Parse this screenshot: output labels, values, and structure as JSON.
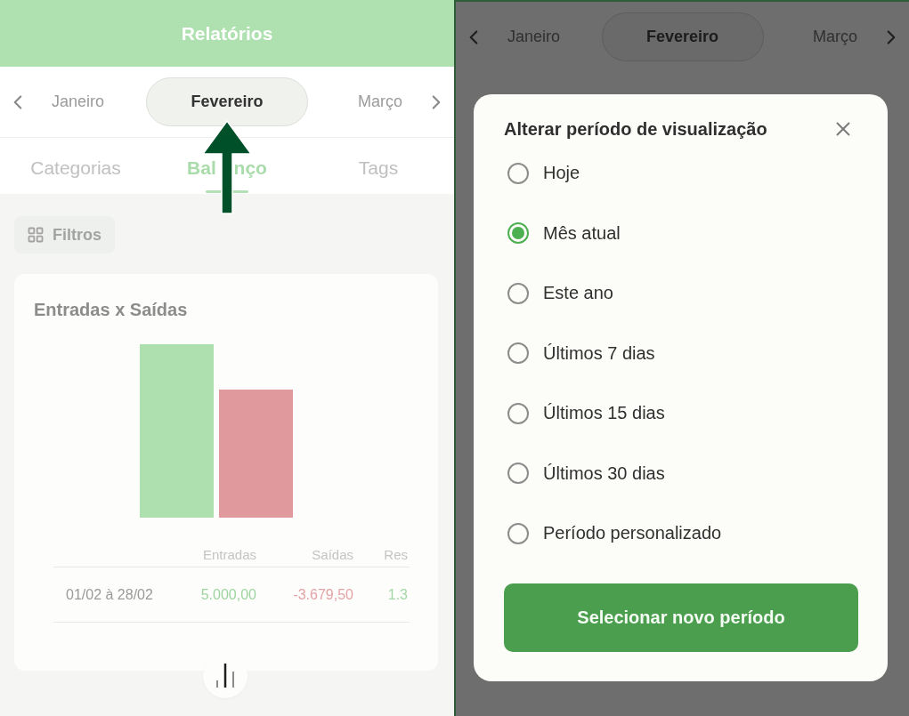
{
  "left_screen": {
    "header": {
      "title": "Relatórios"
    },
    "month_nav": {
      "months": [
        {
          "label": "Janeiro",
          "selected": false
        },
        {
          "label": "Fevereiro",
          "selected": true
        },
        {
          "label": "Março",
          "selected": false
        }
      ]
    },
    "tabs": [
      {
        "label": "Categorias",
        "selected": false
      },
      {
        "label": "Bal nço",
        "selected": true
      },
      {
        "label": "Tags",
        "selected": false
      }
    ],
    "filter_button": {
      "label": "Filtros"
    },
    "card": {
      "title": "Entradas x Saídas",
      "table": {
        "columns": [
          "",
          "Entradas",
          "Saídas",
          "Res"
        ],
        "rows": [
          {
            "cells": [
              {
                "text": "01/02 à 28/02",
                "color": "#9a9a9a"
              },
              {
                "text": "5.000,00",
                "color": "#9fd4a0"
              },
              {
                "text": "-3.679,50",
                "color": "#e3a3a7"
              },
              {
                "text": "1.3",
                "color": "#a4d8a6"
              }
            ]
          }
        ]
      }
    }
  },
  "right_screen": {
    "month_nav": {
      "months": [
        {
          "label": "Janeiro",
          "selected": false
        },
        {
          "label": "Fevereiro",
          "selected": true
        },
        {
          "label": "Março",
          "selected": false
        }
      ]
    },
    "dialog": {
      "title": "Alterar período de visualização",
      "options": [
        {
          "label": "Hoje",
          "selected": false
        },
        {
          "label": "Mês atual",
          "selected": true
        },
        {
          "label": "Este ano",
          "selected": false
        },
        {
          "label": "Últimos 7 dias",
          "selected": false
        },
        {
          "label": "Últimos 15 dias",
          "selected": false
        },
        {
          "label": "Últimos 30 dias",
          "selected": false
        },
        {
          "label": "Período personalizado",
          "selected": false
        }
      ],
      "button": "Selecionar novo período"
    }
  }
}
